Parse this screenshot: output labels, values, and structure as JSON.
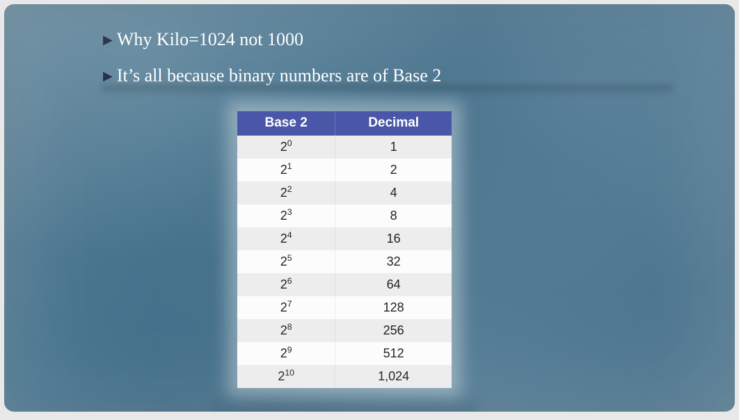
{
  "bullets": {
    "b1": "Why Kilo=1024 not 1000",
    "b2": "It’s all because binary numbers are of Base 2"
  },
  "table": {
    "headers": {
      "base2": "Base 2",
      "decimal": "Decimal"
    },
    "rows": [
      {
        "base": "2",
        "exp": "0",
        "dec": "1"
      },
      {
        "base": "2",
        "exp": "1",
        "dec": "2"
      },
      {
        "base": "2",
        "exp": "2",
        "dec": "4"
      },
      {
        "base": "2",
        "exp": "3",
        "dec": "8"
      },
      {
        "base": "2",
        "exp": "4",
        "dec": "16"
      },
      {
        "base": "2",
        "exp": "5",
        "dec": "32"
      },
      {
        "base": "2",
        "exp": "6",
        "dec": "64"
      },
      {
        "base": "2",
        "exp": "7",
        "dec": "128"
      },
      {
        "base": "2",
        "exp": "8",
        "dec": "256"
      },
      {
        "base": "2",
        "exp": "9",
        "dec": "512"
      },
      {
        "base": "2",
        "exp": "10",
        "dec": "1,024"
      }
    ]
  },
  "chart_data": {
    "type": "table",
    "title": "Powers of 2",
    "columns": [
      "Base 2",
      "Decimal"
    ],
    "rows": [
      [
        "2^0",
        1
      ],
      [
        "2^1",
        2
      ],
      [
        "2^2",
        4
      ],
      [
        "2^3",
        8
      ],
      [
        "2^4",
        16
      ],
      [
        "2^5",
        32
      ],
      [
        "2^6",
        64
      ],
      [
        "2^7",
        128
      ],
      [
        "2^8",
        256
      ],
      [
        "2^9",
        512
      ],
      [
        "2^10",
        1024
      ]
    ]
  }
}
